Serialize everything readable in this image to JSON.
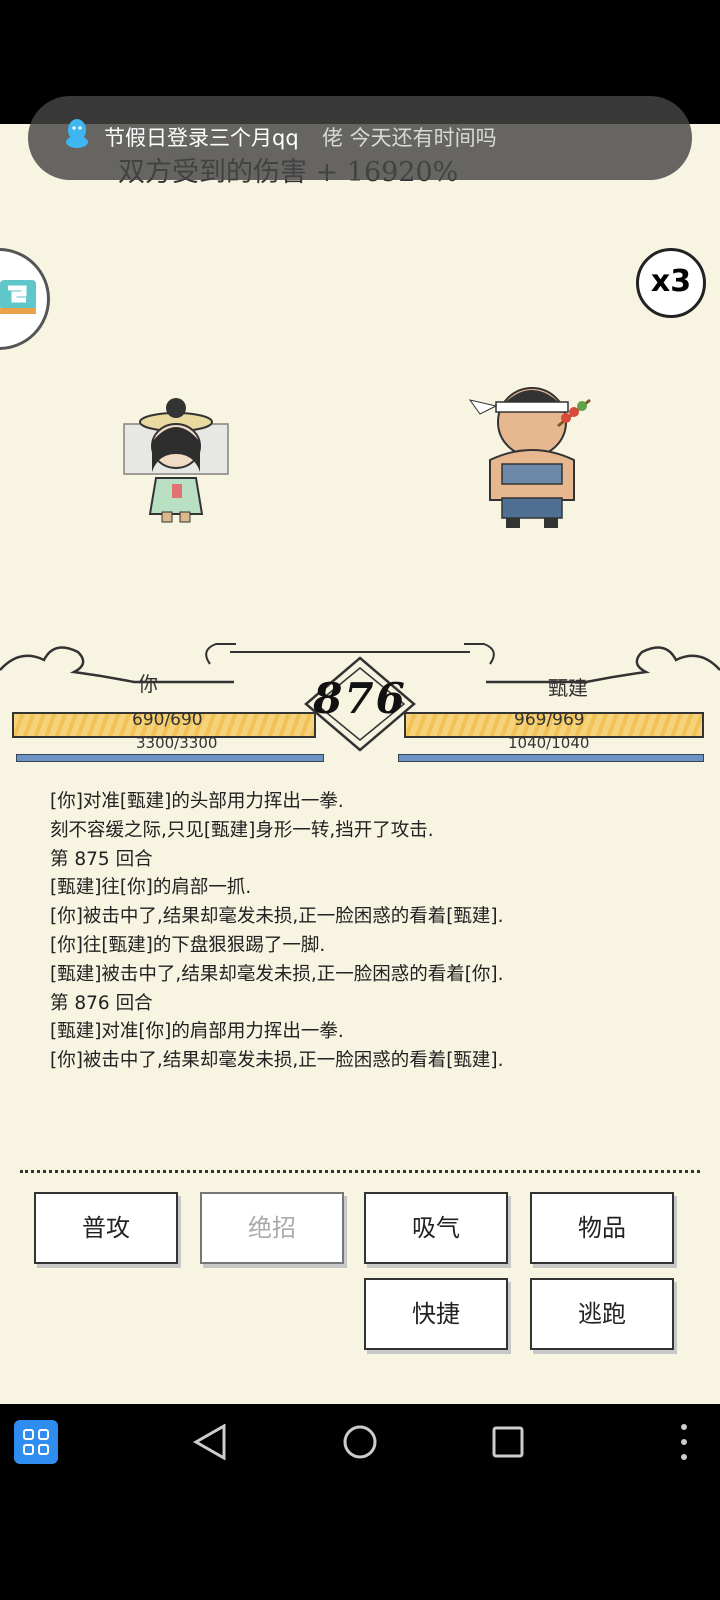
{
  "notification": {
    "title": "节假日登录三个月qq",
    "message": "佬 今天还有时间吗"
  },
  "battle": {
    "damage_text": "双方受到的伤害 + 16920%",
    "speed": "x3",
    "round": "876",
    "player": {
      "name": "你",
      "hp": "690/690",
      "mp": "3300/3300"
    },
    "enemy": {
      "name": "甄建",
      "hp": "969/969",
      "mp": "1040/1040"
    }
  },
  "log": [
    "[你]对准[甄建]的头部用力挥出一拳.",
    "刻不容缓之际,只见[甄建]身形一转,挡开了攻击.",
    "第 875 回合",
    "[甄建]往[你]的肩部一抓.",
    "[你]被击中了,结果却毫发未损,正一脸困惑的看着[甄建].",
    "[你]往[甄建]的下盘狠狠踢了一脚.",
    "[甄建]被击中了,结果却毫发未损,正一脸困惑的看着[你].",
    "第 876 回合",
    "[甄建]对准[你]的肩部用力挥出一拳.",
    "[你]被击中了,结果却毫发未损,正一脸困惑的看着[甄建]."
  ],
  "actions": {
    "attack": "普攻",
    "ultimate": "绝招",
    "breathe": "吸气",
    "items": "物品",
    "quick": "快捷",
    "flee": "逃跑"
  },
  "icons": {
    "notification": "qq-penguin-icon",
    "apps": "app-grid-icon",
    "back": "back-triangle-icon",
    "home": "home-circle-icon",
    "recents": "recents-square-icon",
    "more": "more-vertical-icon"
  }
}
